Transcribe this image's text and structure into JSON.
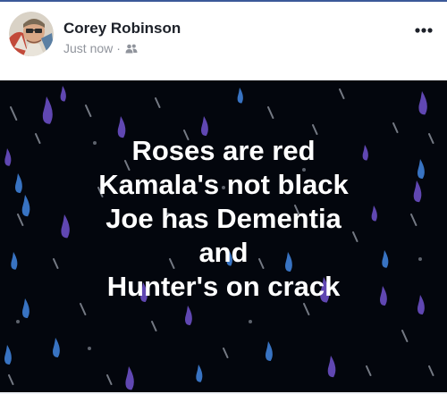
{
  "post": {
    "author": "Corey Robinson",
    "timestamp": "Just now",
    "separator": "·",
    "audience_icon": "friends-icon",
    "more_icon": "more-options-icon",
    "background_text_lines": [
      "Roses are red",
      "Kamala's not black",
      "Joe has Dementia",
      "and",
      "Hunter's on crack"
    ]
  },
  "colors": {
    "background": "#03060d",
    "drop_purple": "#6a4fc4",
    "drop_blue": "#3e7fd6",
    "streak": "#9aa0ab",
    "text": "#ffffff",
    "name": "#1d2129",
    "meta": "#90949c"
  }
}
